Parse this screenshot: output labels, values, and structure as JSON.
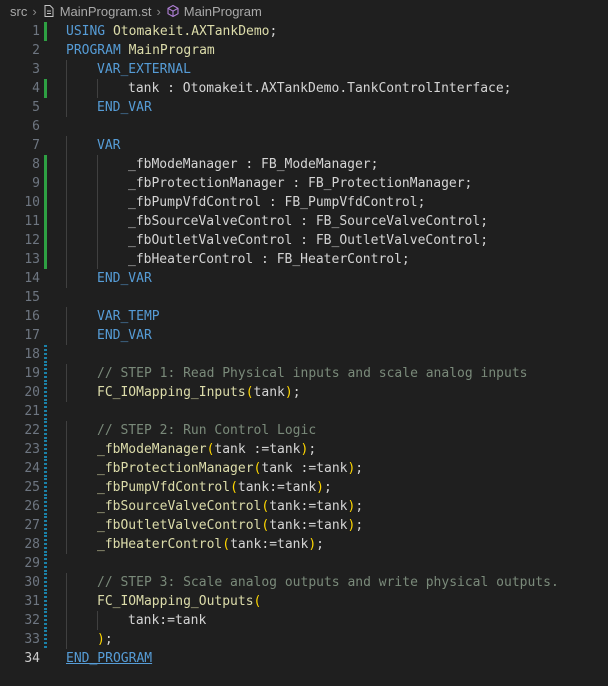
{
  "breadcrumb": {
    "folder": "src",
    "file": "MainProgram.st",
    "symbol": "MainProgram"
  },
  "colors": {
    "background": "#1f1f1f",
    "keyword": "#569cd6",
    "function": "#dcdcaa",
    "comment": "#7a8a7a",
    "git_added": "#2ea043",
    "git_modified": "#1b81a8"
  },
  "lines": [
    {
      "n": "1",
      "git": "added",
      "indent": 0,
      "tokens": [
        [
          "kw",
          "USING"
        ],
        [
          "plain",
          " "
        ],
        [
          "prog",
          "Otomakeit.AXTankDemo"
        ],
        [
          "plain",
          ";"
        ]
      ]
    },
    {
      "n": "2",
      "git": "",
      "indent": 0,
      "tokens": [
        [
          "kw",
          "PROGRAM"
        ],
        [
          "plain",
          " "
        ],
        [
          "prog",
          "MainProgram"
        ]
      ]
    },
    {
      "n": "3",
      "git": "",
      "indent": 1,
      "tokens": [
        [
          "kw",
          "VAR_EXTERNAL"
        ]
      ]
    },
    {
      "n": "4",
      "git": "added",
      "indent": 2,
      "tokens": [
        [
          "plain",
          "tank : Otomakeit.AXTankDemo.TankControlInterface;"
        ]
      ]
    },
    {
      "n": "5",
      "git": "",
      "indent": 1,
      "tokens": [
        [
          "kw",
          "END_VAR"
        ]
      ]
    },
    {
      "n": "6",
      "git": "",
      "indent": 0,
      "tokens": []
    },
    {
      "n": "7",
      "git": "",
      "indent": 1,
      "tokens": [
        [
          "kw",
          "VAR"
        ]
      ]
    },
    {
      "n": "8",
      "git": "added",
      "indent": 2,
      "tokens": [
        [
          "plain",
          "_fbModeManager : FB_ModeManager;"
        ]
      ]
    },
    {
      "n": "9",
      "git": "added",
      "indent": 2,
      "tokens": [
        [
          "plain",
          "_fbProtectionManager : FB_ProtectionManager;"
        ]
      ]
    },
    {
      "n": "10",
      "git": "added",
      "indent": 2,
      "tokens": [
        [
          "plain",
          "_fbPumpVfdControl : FB_PumpVfdControl;"
        ]
      ]
    },
    {
      "n": "11",
      "git": "added",
      "indent": 2,
      "tokens": [
        [
          "plain",
          "_fbSourceValveControl : FB_SourceValveControl;"
        ]
      ]
    },
    {
      "n": "12",
      "git": "added",
      "indent": 2,
      "tokens": [
        [
          "plain",
          "_fbOutletValveControl : FB_OutletValveControl;"
        ]
      ]
    },
    {
      "n": "13",
      "git": "added",
      "indent": 2,
      "tokens": [
        [
          "plain",
          "_fbHeaterControl : FB_HeaterControl;"
        ]
      ]
    },
    {
      "n": "14",
      "git": "",
      "indent": 1,
      "tokens": [
        [
          "kw",
          "END_VAR"
        ]
      ]
    },
    {
      "n": "15",
      "git": "",
      "indent": 0,
      "tokens": []
    },
    {
      "n": "16",
      "git": "",
      "indent": 1,
      "tokens": [
        [
          "kw",
          "VAR_TEMP"
        ]
      ]
    },
    {
      "n": "17",
      "git": "",
      "indent": 1,
      "tokens": [
        [
          "kw",
          "END_VAR"
        ]
      ]
    },
    {
      "n": "18",
      "git": "modified",
      "indent": 0,
      "tokens": []
    },
    {
      "n": "19",
      "git": "modified",
      "indent": 1,
      "tokens": [
        [
          "cmt",
          "// STEP 1: Read Physical inputs and scale analog inputs"
        ]
      ]
    },
    {
      "n": "20",
      "git": "modified",
      "indent": 1,
      "tokens": [
        [
          "fn",
          "FC_IOMapping_Inputs"
        ],
        [
          "paren",
          "("
        ],
        [
          "plain",
          "tank"
        ],
        [
          "paren",
          ")"
        ],
        [
          "plain",
          ";"
        ]
      ]
    },
    {
      "n": "21",
      "git": "modified",
      "indent": 0,
      "tokens": []
    },
    {
      "n": "22",
      "git": "modified",
      "indent": 1,
      "tokens": [
        [
          "cmt",
          "// STEP 2: Run Control Logic"
        ]
      ]
    },
    {
      "n": "23",
      "git": "modified",
      "indent": 1,
      "tokens": [
        [
          "fn",
          "_fbModeManager"
        ],
        [
          "paren",
          "("
        ],
        [
          "plain",
          "tank :=tank"
        ],
        [
          "paren",
          ")"
        ],
        [
          "plain",
          ";"
        ]
      ]
    },
    {
      "n": "24",
      "git": "modified",
      "indent": 1,
      "tokens": [
        [
          "fn",
          "_fbProtectionManager"
        ],
        [
          "paren",
          "("
        ],
        [
          "plain",
          "tank :=tank"
        ],
        [
          "paren",
          ")"
        ],
        [
          "plain",
          ";"
        ]
      ]
    },
    {
      "n": "25",
      "git": "modified",
      "indent": 1,
      "tokens": [
        [
          "fn",
          "_fbPumpVfdControl"
        ],
        [
          "paren",
          "("
        ],
        [
          "plain",
          "tank:=tank"
        ],
        [
          "paren",
          ")"
        ],
        [
          "plain",
          ";"
        ]
      ]
    },
    {
      "n": "26",
      "git": "modified",
      "indent": 1,
      "tokens": [
        [
          "fn",
          "_fbSourceValveControl"
        ],
        [
          "paren",
          "("
        ],
        [
          "plain",
          "tank:=tank"
        ],
        [
          "paren",
          ")"
        ],
        [
          "plain",
          ";"
        ]
      ]
    },
    {
      "n": "27",
      "git": "modified",
      "indent": 1,
      "tokens": [
        [
          "fn",
          "_fbOutletValveControl"
        ],
        [
          "paren",
          "("
        ],
        [
          "plain",
          "tank:=tank"
        ],
        [
          "paren",
          ")"
        ],
        [
          "plain",
          ";"
        ]
      ]
    },
    {
      "n": "28",
      "git": "modified",
      "indent": 1,
      "tokens": [
        [
          "fn",
          "_fbHeaterControl"
        ],
        [
          "paren",
          "("
        ],
        [
          "plain",
          "tank:=tank"
        ],
        [
          "paren",
          ")"
        ],
        [
          "plain",
          ";"
        ]
      ]
    },
    {
      "n": "29",
      "git": "modified",
      "indent": 0,
      "tokens": []
    },
    {
      "n": "30",
      "git": "modified",
      "indent": 1,
      "tokens": [
        [
          "cmt",
          "// STEP 3: Scale analog outputs and write physical outputs."
        ]
      ]
    },
    {
      "n": "31",
      "git": "modified",
      "indent": 1,
      "tokens": [
        [
          "fn",
          "FC_IOMapping_Outputs"
        ],
        [
          "paren",
          "("
        ]
      ]
    },
    {
      "n": "32",
      "git": "modified",
      "indent": 2,
      "tokens": [
        [
          "plain",
          "tank:=tank"
        ]
      ]
    },
    {
      "n": "33",
      "git": "modified",
      "indent": 1,
      "tokens": [
        [
          "paren",
          ")"
        ],
        [
          "plain",
          ";"
        ]
      ]
    },
    {
      "n": "34",
      "git": "",
      "indent": 0,
      "current": true,
      "tokens": [
        [
          "end",
          "END_PROGRAM"
        ]
      ]
    }
  ]
}
